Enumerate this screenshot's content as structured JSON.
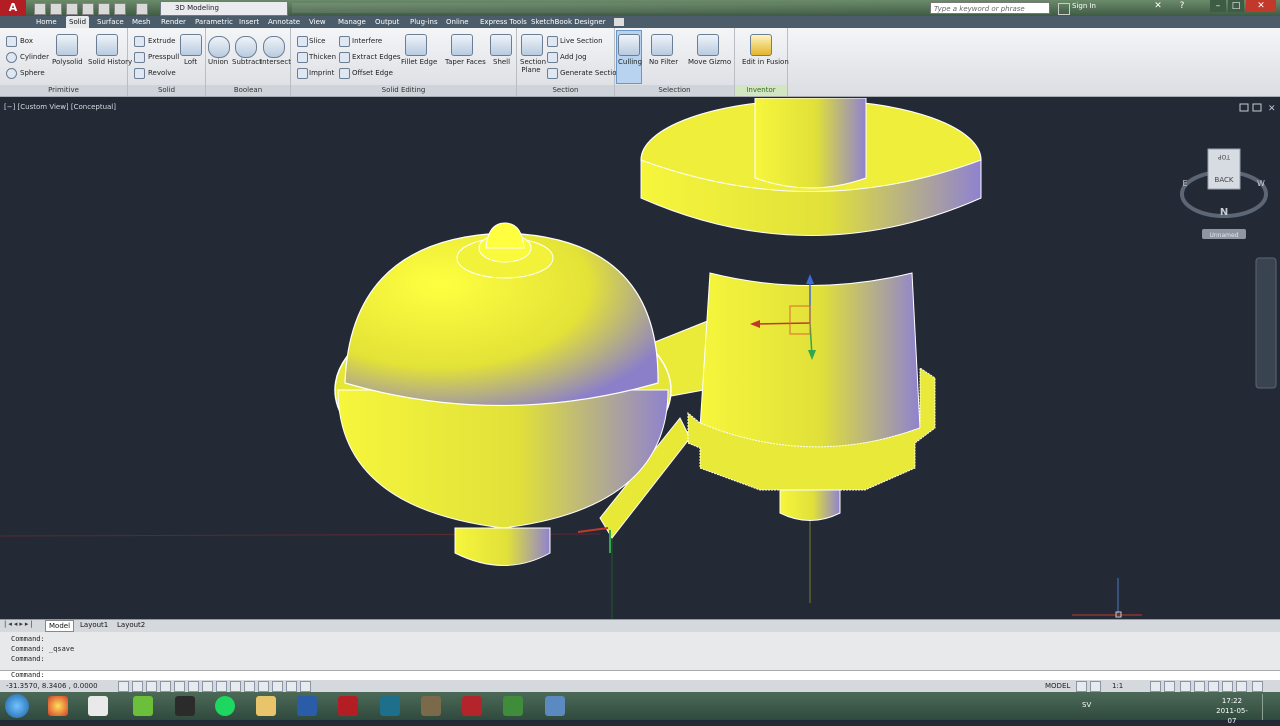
{
  "app": {
    "menu_letter": "A",
    "workspace": "3D Modeling"
  },
  "search": {
    "placeholder": "Type a keyword or phrase"
  },
  "signin": "Sign In",
  "tabs": [
    "Home",
    "Solid",
    "Surface",
    "Mesh",
    "Render",
    "Parametric",
    "Insert",
    "Annotate",
    "View",
    "Manage",
    "Output",
    "Plug-ins",
    "Online",
    "Express Tools",
    "SketchBook Designer"
  ],
  "active_tab": "Solid",
  "ribbon": {
    "primitive": {
      "title": "Primitive",
      "items": [
        "Box",
        "Cylinder",
        "Sphere"
      ]
    },
    "solid": {
      "title": "Solid",
      "big": [
        "Polysolid",
        "Solid History"
      ],
      "small": [
        "Extrude",
        "Presspull",
        "Revolve"
      ],
      "loft": "Loft"
    },
    "boolean": {
      "title": "Boolean",
      "items": [
        "Union",
        "Subtract",
        "Intersect"
      ]
    },
    "solid_editing": {
      "title": "Solid Editing",
      "small1": [
        "Slice",
        "Thicken",
        "Imprint"
      ],
      "small2": [
        "Interfere",
        "Extract Edges",
        "Offset Edge"
      ],
      "big": [
        "Fillet Edge",
        "Taper Faces",
        "Shell"
      ]
    },
    "section": {
      "title": "Section",
      "big": "Section Plane",
      "small": [
        "Live Section",
        "Add Jog",
        "Generate Section"
      ]
    },
    "selection": {
      "title": "Selection",
      "big": [
        "Culling",
        "No Filter",
        "Move Gizmo"
      ]
    },
    "inventor": {
      "title": "Inventor Fusion",
      "big": "Edit in Fusion"
    }
  },
  "viewport": {
    "label": "[−] [Custom View] [Conceptual]",
    "viewcube_face": "BACK",
    "viewcube_top": "TOP",
    "compass_n": "N",
    "compass_e": "E",
    "compass_w": "W",
    "ucs_name": "Unnamed"
  },
  "layout_tabs": [
    "Model",
    "Layout1",
    "Layout2"
  ],
  "command_history": [
    "Command:",
    "Command: _qsave",
    "Command:"
  ],
  "command_prompt": "Command:",
  "status": {
    "coords": "-31.3570, 8.3406 , 0.0000",
    "model": "MODEL",
    "scale": "1:1"
  },
  "taskbar": {
    "lang": "SV",
    "time": "17:22",
    "date": "2011-05-07"
  },
  "colors": {
    "model_fill": "#ffff3a",
    "viewport_bg": "#232a36",
    "ribbon_bg": "#e7e9ec"
  }
}
